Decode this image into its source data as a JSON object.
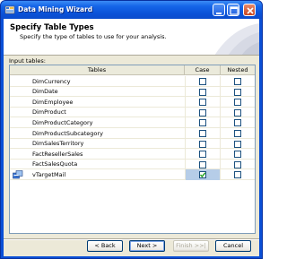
{
  "window": {
    "title": "Data Mining Wizard"
  },
  "header": {
    "title": "Specify Table Types",
    "subtitle": "Specify the type of tables to use for your analysis."
  },
  "grid": {
    "label": "Input tables:",
    "columns": [
      "Tables",
      "Case",
      "Nested"
    ],
    "rows": [
      {
        "name": "DimCurrency",
        "case": false,
        "nested": false,
        "icon": ""
      },
      {
        "name": "DimDate",
        "case": false,
        "nested": false,
        "icon": ""
      },
      {
        "name": "DimEmployee",
        "case": false,
        "nested": false,
        "icon": ""
      },
      {
        "name": "DimProduct",
        "case": false,
        "nested": false,
        "icon": ""
      },
      {
        "name": "DimProductCategory",
        "case": false,
        "nested": false,
        "icon": ""
      },
      {
        "name": "DimProductSubcategory",
        "case": false,
        "nested": false,
        "icon": ""
      },
      {
        "name": "DimSalesTerritory",
        "case": false,
        "nested": false,
        "icon": ""
      },
      {
        "name": "FactResellerSales",
        "case": false,
        "nested": false,
        "icon": ""
      },
      {
        "name": "FactSalesQuota",
        "case": false,
        "nested": false,
        "icon": ""
      },
      {
        "name": "vTargetMail",
        "case": true,
        "nested": false,
        "icon": "case-table-icon"
      }
    ]
  },
  "buttons": {
    "back": "< Back",
    "next": "Next >",
    "finish": "Finish >>|",
    "cancel": "Cancel"
  },
  "colors": {
    "titlebar": "#0a52d8",
    "face": "#ece9d8",
    "selected_cell": "#b6cde8"
  }
}
